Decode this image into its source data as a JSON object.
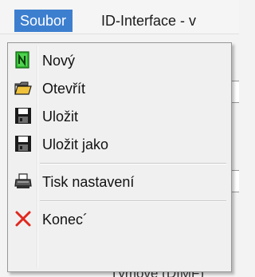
{
  "menubar": {
    "active_menu": "Soubor",
    "window_title": "ID-Interface - v"
  },
  "background": {
    "bottom_text": "Týmové (DIMF)"
  },
  "dropdown": {
    "items": [
      {
        "label": "Nový",
        "icon": "new-document-icon"
      },
      {
        "label": "Otevřít",
        "icon": "open-folder-icon"
      },
      {
        "label": "Uložit",
        "icon": "save-disk-icon"
      },
      {
        "label": "Uložit jako",
        "icon": "save-as-disk-icon"
      },
      {
        "label": "Tisk nastavení",
        "icon": "printer-icon"
      },
      {
        "label": "Konec´",
        "icon": "close-x-icon"
      }
    ]
  },
  "colors": {
    "menu_highlight": "#3d7fcf",
    "menu_background": "#f0f0f0",
    "new_icon_green": "#2db52d",
    "close_icon_red": "#e0281e"
  }
}
